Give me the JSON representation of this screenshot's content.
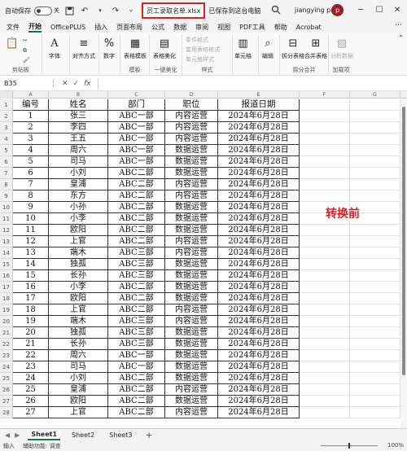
{
  "titlebar": {
    "autosave_label": "自动保存",
    "toggle_state": "关",
    "filename": "员工录取名单.xlsx",
    "saved_status": "已保存到这台电脑",
    "username": "jiangying pan",
    "avatar_initial": "p"
  },
  "menu": {
    "tabs": [
      "文件",
      "开始",
      "OfficePLUS",
      "插入",
      "页面布局",
      "公式",
      "数据",
      "审阅",
      "视图",
      "PDF工具",
      "帮助",
      "Acrobat"
    ],
    "active_index": 1
  },
  "ribbon": {
    "clipboard": "剪贴板",
    "font": "字体",
    "align": "对齐方式",
    "number": "数字",
    "table_template": "表格模板",
    "table_beautify": "表格美化",
    "conditional_format": "条件格式",
    "table_format": "套用表格格式",
    "cell_style": "单元格样式",
    "cells": "单元格",
    "edit": "编辑",
    "split_table": "拆分表格",
    "merge_table": "合并表格",
    "analyze": "分析数据",
    "group_template": "模板",
    "group_beautify": "一键美化",
    "group_style": "样式",
    "group_split_merge": "拆分合并",
    "group_addins": "加载项"
  },
  "formulabar": {
    "namebox": "B35",
    "fx": "fx"
  },
  "columns": [
    "A",
    "B",
    "C",
    "D",
    "E",
    "F",
    "G"
  ],
  "table": {
    "headers": [
      "编号",
      "姓名",
      "部门",
      "职位",
      "报道日期"
    ],
    "rows": [
      [
        "1",
        "张三",
        "ABC一部",
        "内容运营",
        "2024年6月28日"
      ],
      [
        "2",
        "李四",
        "ABC一部",
        "内容运营",
        "2024年6月28日"
      ],
      [
        "3",
        "王五",
        "ABC一部",
        "内容运营",
        "2024年6月28日"
      ],
      [
        "4",
        "周六",
        "ABC一部",
        "数据运营",
        "2024年6月28日"
      ],
      [
        "5",
        "司马",
        "ABC一部",
        "数据运营",
        "2024年6月28日"
      ],
      [
        "6",
        "小刘",
        "ABC二部",
        "数据运营",
        "2024年6月28日"
      ],
      [
        "7",
        "皇浦",
        "ABC二部",
        "内容运营",
        "2024年6月28日"
      ],
      [
        "8",
        "东方",
        "ABC二部",
        "内容运营",
        "2024年6月28日"
      ],
      [
        "9",
        "小孙",
        "ABC二部",
        "数据运营",
        "2024年6月28日"
      ],
      [
        "10",
        "小李",
        "ABC二部",
        "数据运营",
        "2024年6月28日"
      ],
      [
        "11",
        "欧阳",
        "ABC二部",
        "数据运营",
        "2024年6月28日"
      ],
      [
        "12",
        "上官",
        "ABC二部",
        "内容运营",
        "2024年6月28日"
      ],
      [
        "13",
        "端木",
        "ABC三部",
        "内容运营",
        "2024年6月28日"
      ],
      [
        "14",
        "独孤",
        "ABC三部",
        "数据运营",
        "2024年6月28日"
      ],
      [
        "15",
        "长孙",
        "ABC三部",
        "数据运营",
        "2024年6月28日"
      ],
      [
        "16",
        "小李",
        "ABC二部",
        "数据运营",
        "2024年6月28日"
      ],
      [
        "17",
        "欧阳",
        "ABC二部",
        "数据运营",
        "2024年6月28日"
      ],
      [
        "18",
        "上官",
        "ABC二部",
        "内容运营",
        "2024年6月28日"
      ],
      [
        "19",
        "端木",
        "ABC三部",
        "内容运营",
        "2024年6月28日"
      ],
      [
        "20",
        "独孤",
        "ABC三部",
        "数据运营",
        "2024年6月28日"
      ],
      [
        "21",
        "长孙",
        "ABC三部",
        "数据运营",
        "2024年6月28日"
      ],
      [
        "22",
        "周六",
        "ABC一部",
        "数据运营",
        "2024年6月28日"
      ],
      [
        "23",
        "司马",
        "ABC一部",
        "数据运营",
        "2024年6月28日"
      ],
      [
        "24",
        "小刘",
        "ABC二部",
        "数据运营",
        "2024年6月28日"
      ],
      [
        "25",
        "皇浦",
        "ABC二部",
        "内容运营",
        "2024年6月28日"
      ],
      [
        "26",
        "欧阳",
        "ABC二部",
        "数据运营",
        "2024年6月28日"
      ],
      [
        "27",
        "上官",
        "ABC二部",
        "内容运营",
        "2024年6月28日"
      ]
    ]
  },
  "annotation": "转换前",
  "sheets": {
    "tabs": [
      "Sheet1",
      "Sheet2",
      "Sheet3"
    ],
    "active_index": 0,
    "add": "+"
  },
  "status": {
    "mode": "输入",
    "accessibility": "辅助功能: 调查",
    "zoom": "100%"
  },
  "colors": {
    "accent": "#107c41",
    "highlight_red": "#e81b23"
  }
}
